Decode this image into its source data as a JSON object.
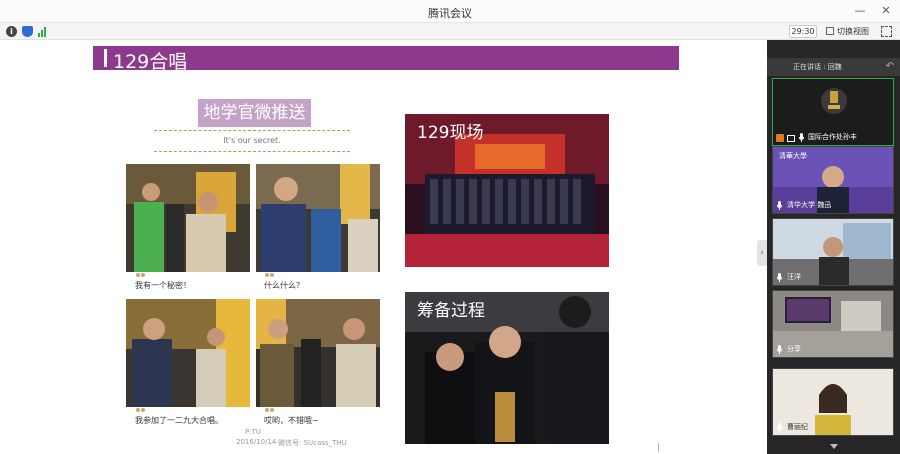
{
  "window": {
    "title": "腾讯会议"
  },
  "toolbar": {
    "info_glyph": "i",
    "timer": "29:30",
    "switch_view_label": "切换视图"
  },
  "slide": {
    "header_title": "129合唱",
    "wechat_banner": "地学官微推送",
    "wechat_subtitle": "It's our secret.",
    "captions": [
      "我有一个秘密！",
      "什么什么？",
      "我参加了一二九大合唱。",
      "哎哟，不错哦~"
    ],
    "section_live": "129现场",
    "section_prep": "筹备过程",
    "footer_author": "P:TU",
    "footer_date": "2016/10/14",
    "footer_watermark": "微信号: SUcass_THU"
  },
  "side_panel": {
    "top_label": "正在讲话 : 回魏",
    "tiles": [
      {
        "name": "国际合作处孙丰",
        "icon": "cup-avatar-icon"
      },
      {
        "name": "清华大学 魏迅",
        "icon": "mic-icon"
      },
      {
        "name": "汪洋",
        "icon": "mic-icon"
      },
      {
        "name": "分享",
        "icon": "mic-icon"
      },
      {
        "name": "曹丽纪",
        "icon": "mic-icon"
      }
    ],
    "tile2_logo": "清華大學"
  },
  "colors": {
    "header_purple": "#8d3a8e",
    "banner_lilac": "#c5a3c9",
    "panel_dark": "#262626",
    "active_green": "#2fa84f"
  }
}
